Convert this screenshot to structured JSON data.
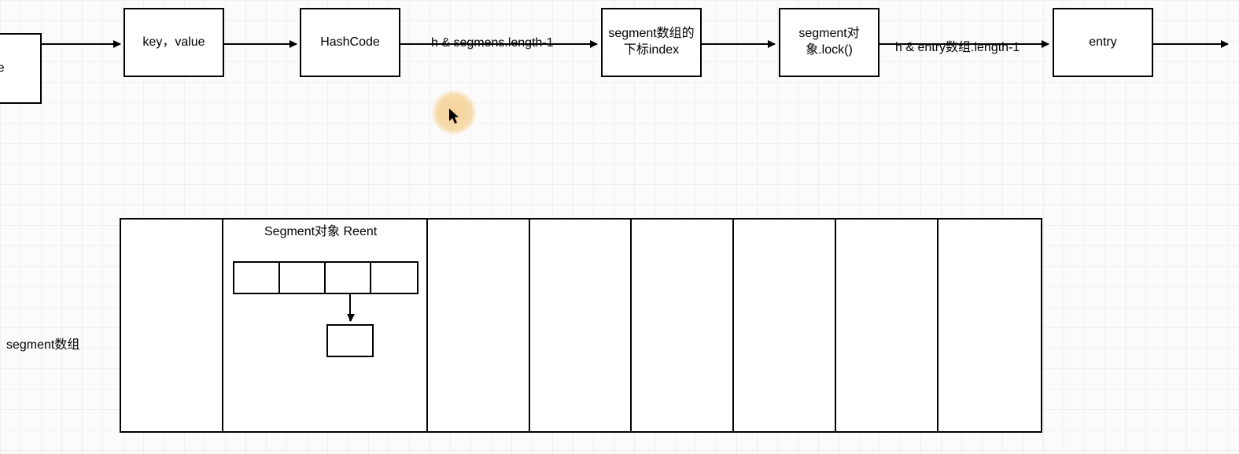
{
  "flow": {
    "node_truncated_left": "alue",
    "node_keyvalue": "key，value",
    "node_hashcode": "HashCode",
    "label_h_segments": "h & segmens.length-1",
    "node_segment_index": "segment数组的下标index",
    "node_segment_lock": "segment对象.lock()",
    "label_h_entry": "h & entry数组.length-1",
    "node_entry": "entry"
  },
  "bottom": {
    "label_left": "segment数组",
    "segment_cell2_title": "Segment对象 Reent"
  },
  "geometry": {
    "segment_table_cells": 9
  }
}
